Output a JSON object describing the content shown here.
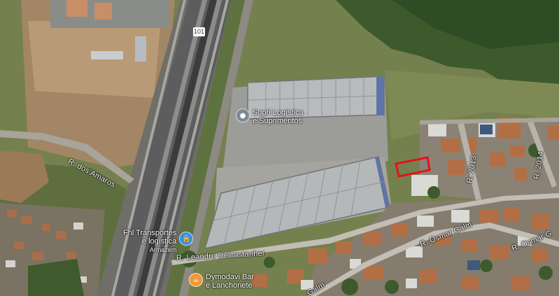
{
  "map": {
    "highway_shield": "101",
    "streets": {
      "dos_amaros": "R. dos Amaros",
      "leandro": "R. Leandro Delcastanher",
      "osmar_galm_1": "R. Osmar Galm",
      "osmar_galm_2": "R. Osmar G",
      "galm_low": "Galm",
      "r2013": "R. 2013",
      "r2014": "R. 2014"
    },
    "pois": [
      {
        "name": "Supri Logística\ne Suprimentos",
        "icon": "building-icon",
        "color": "#7b8a96"
      },
      {
        "name": "Fhl Transportes\ne logística",
        "sub": "Armazém",
        "icon": "lock-icon",
        "color": "#3c8ee0"
      },
      {
        "name": "Dymodavi Bar\ne Lanchonete",
        "icon": "food-icon",
        "color": "#f09a37"
      }
    ]
  }
}
